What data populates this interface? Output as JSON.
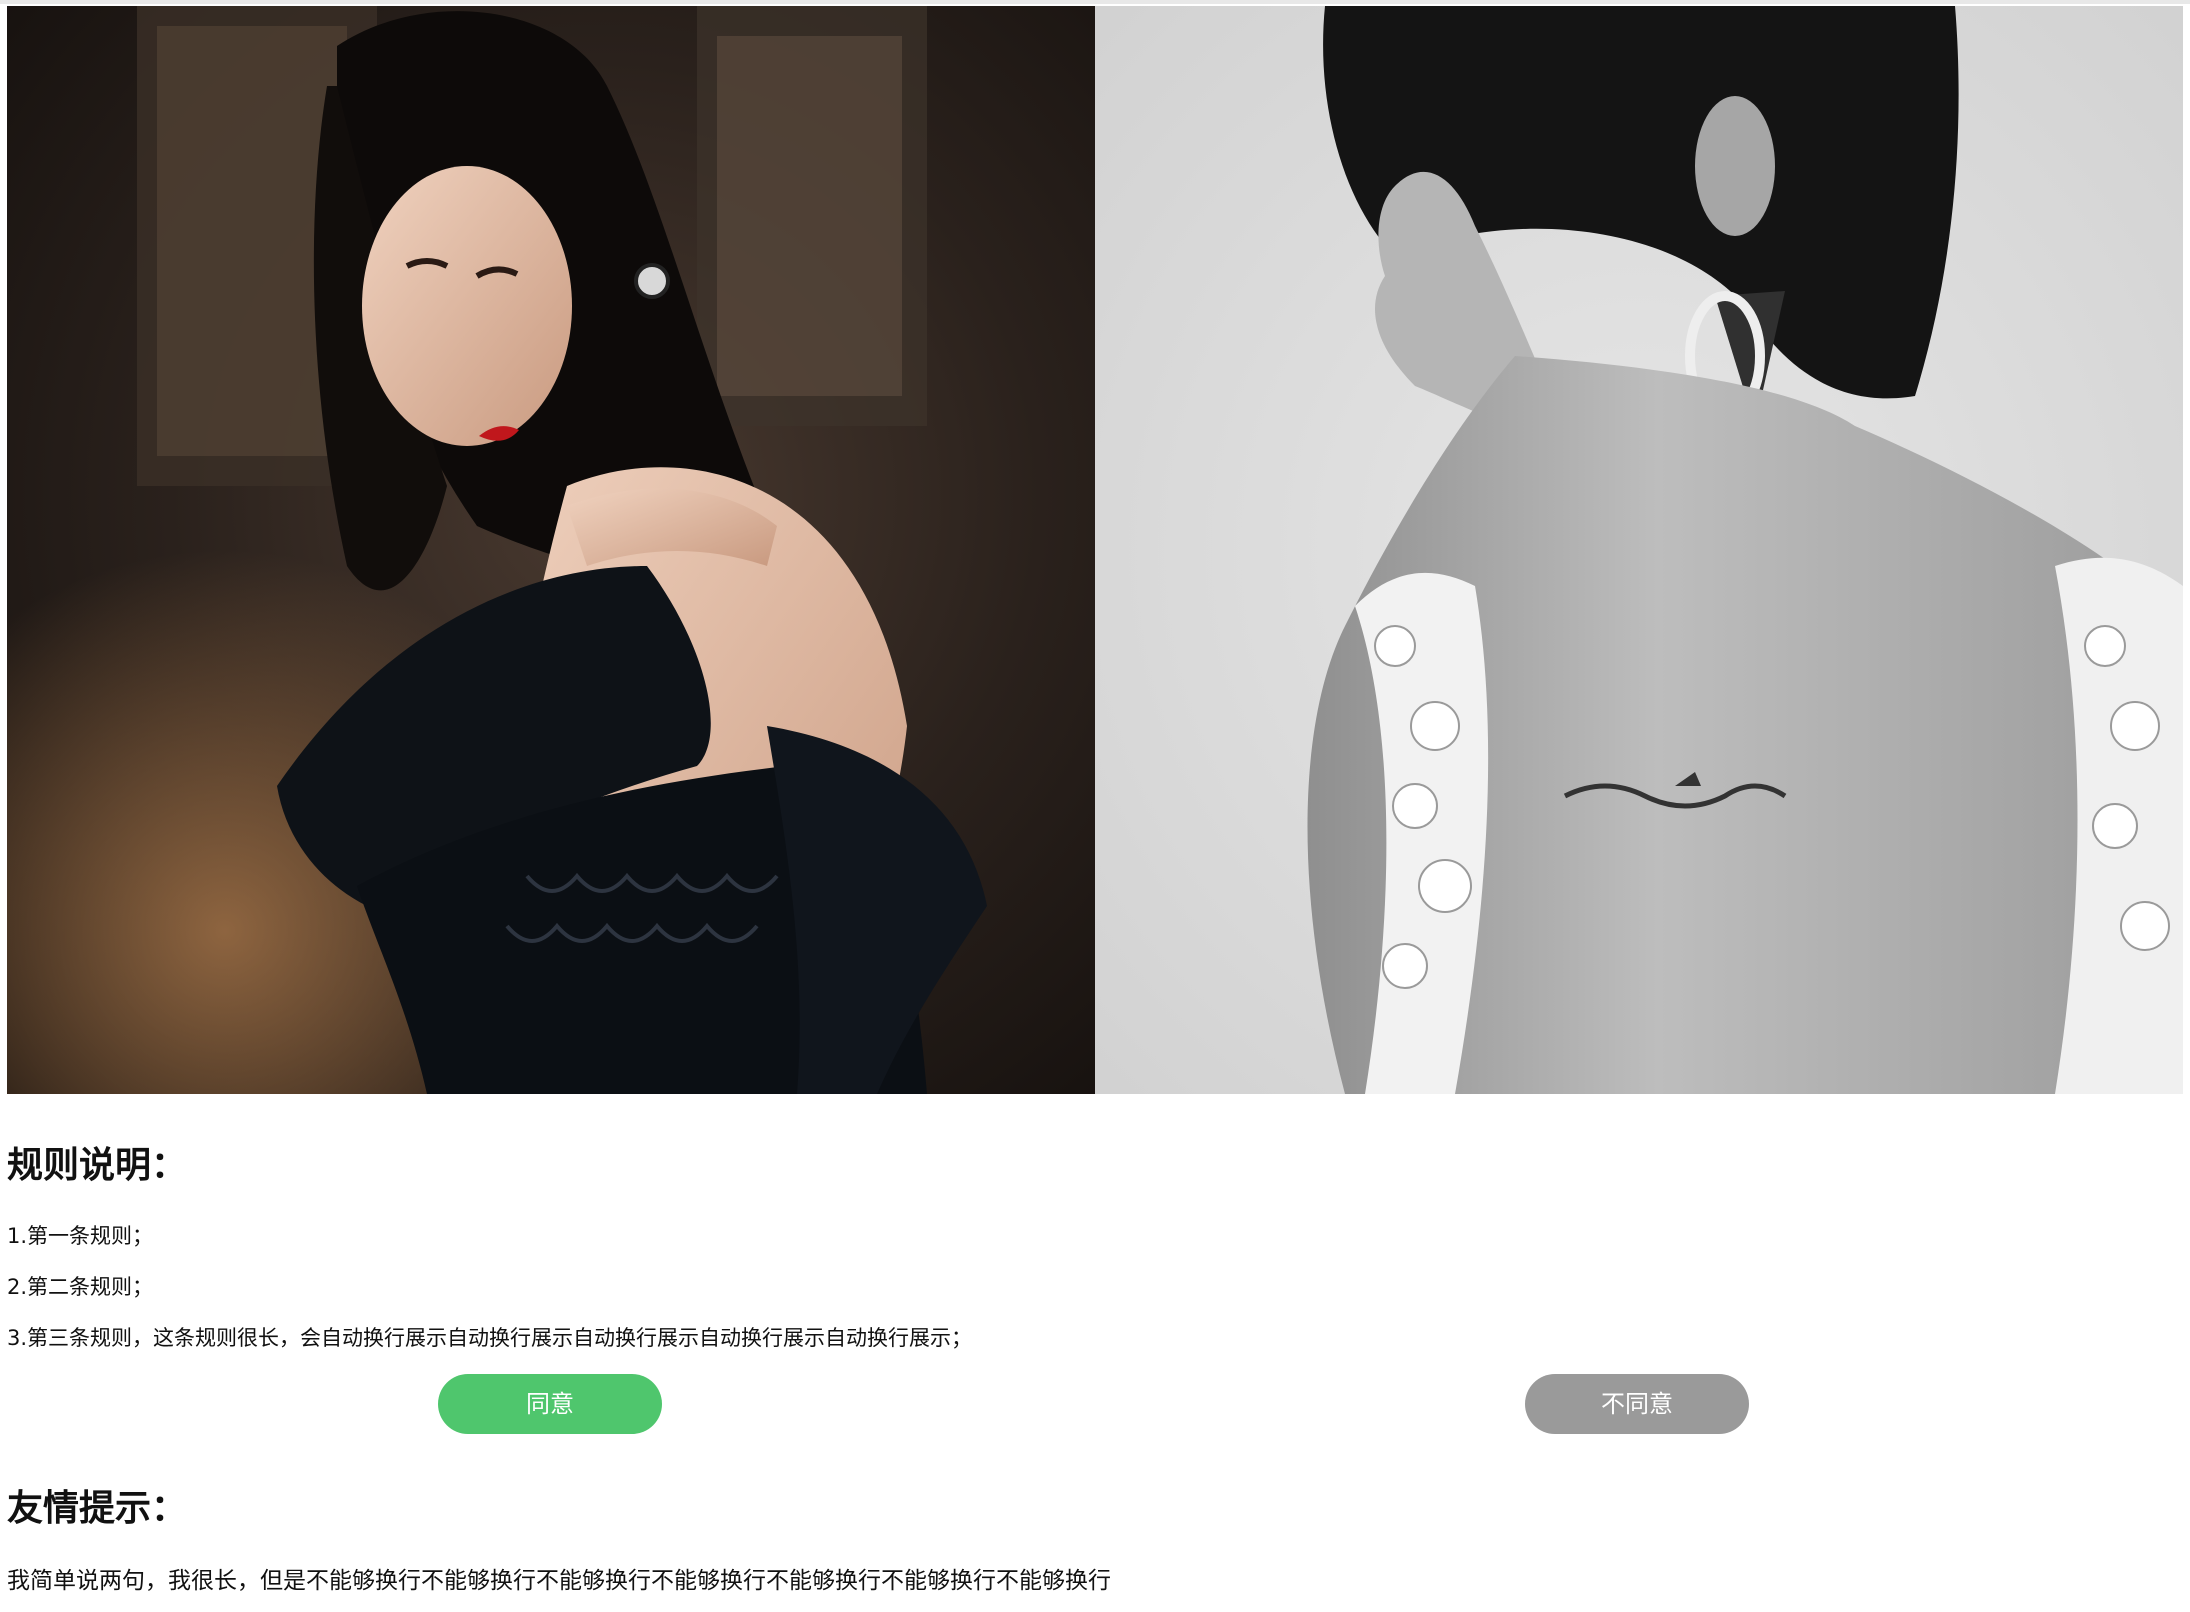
{
  "images": [
    {
      "name": "photo-woman-black-dress",
      "alt": ""
    },
    {
      "name": "photo-woman-lace-back",
      "alt": ""
    }
  ],
  "rules": {
    "heading": "规则说明：",
    "items": [
      "1.第一条规则；",
      "2.第二条规则；",
      "3.第三条规则，这条规则很长，会自动换行展示自动换行展示自动换行展示自动换行展示自动换行展示；"
    ]
  },
  "buttons": {
    "agree_label": "同意",
    "disagree_label": "不同意"
  },
  "tips": {
    "heading": "友情提示：",
    "text": "我简单说两句，我很长，但是不能够换行不能够换行不能够换行不能够换行不能够换行不能够换行不能够换行"
  },
  "colors": {
    "agree_button": "#4fc66d",
    "disagree_button": "#9a9a9a"
  }
}
